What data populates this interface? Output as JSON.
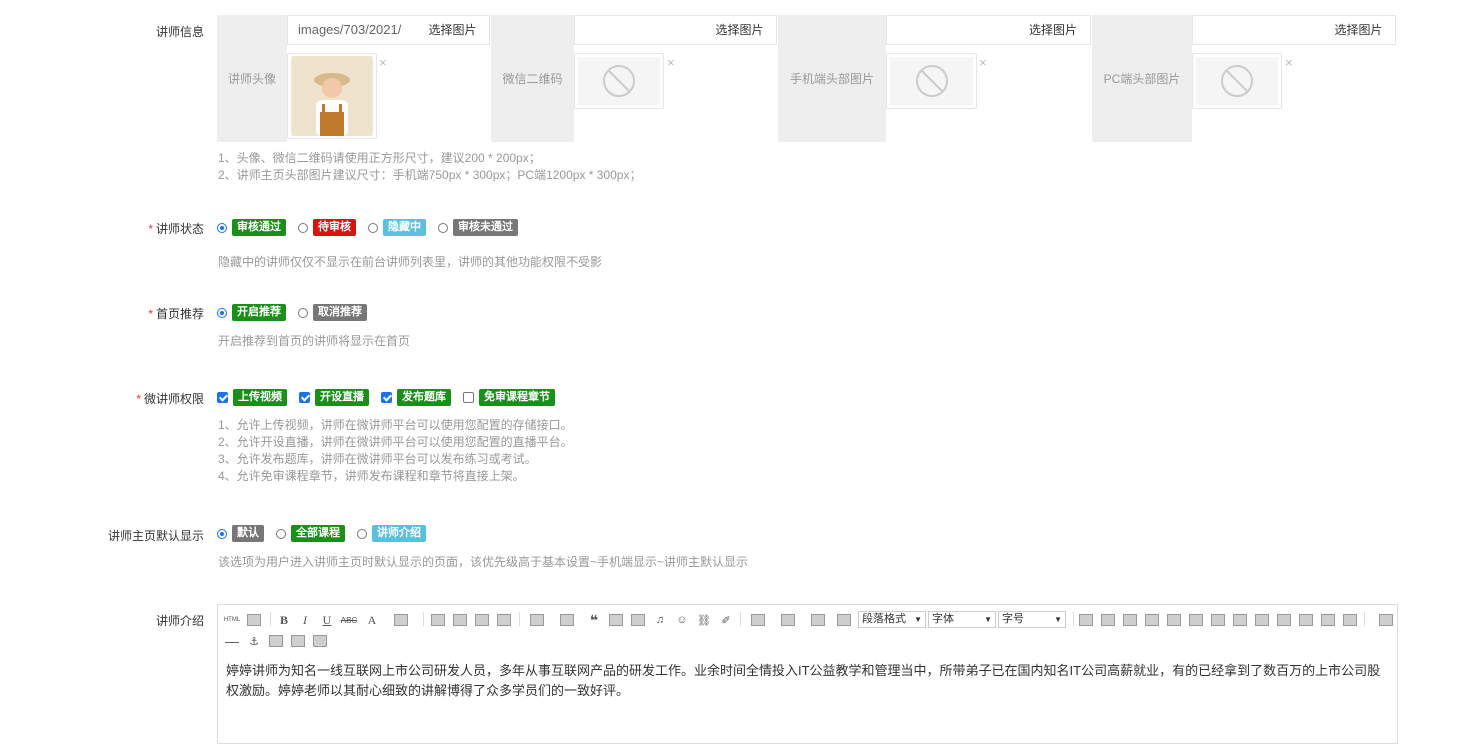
{
  "teacher_info": {
    "label": "讲师信息",
    "pickers": [
      {
        "side_label": "讲师头像",
        "value": "images/703/2021/",
        "button": "选择图片",
        "close": "×"
      },
      {
        "side_label": "微信二维码",
        "value": "",
        "button": "选择图片",
        "close": "×",
        "placeholder_text": "暂无图片"
      },
      {
        "side_label": "手机端头部图片",
        "value": "",
        "button": "选择图片",
        "close": "×",
        "placeholder_text": "暂无图片"
      },
      {
        "side_label": "PC端头部图片",
        "value": "",
        "button": "选择图片",
        "close": "×",
        "placeholder_text": "暂无图片"
      }
    ],
    "hints": [
      "1、头像、微信二维码请使用正方形尺寸，建议200 * 200px；",
      "2、讲师主页头部图片建议尺寸：手机端750px * 300px；PC端1200px * 300px；"
    ]
  },
  "status": {
    "label": "讲师状态",
    "options": [
      {
        "label": "审核通过",
        "color": "#1a8f1a",
        "checked": true
      },
      {
        "label": "待审核",
        "color": "#d9140f",
        "checked": false
      },
      {
        "label": "隐藏中",
        "color": "#5bc0de",
        "checked": false
      },
      {
        "label": "审核未通过",
        "color": "#777777",
        "checked": false
      }
    ],
    "hint": "隐藏中的讲师仅仅不显示在前台讲师列表里，讲师的其他功能权限不受影"
  },
  "recommend": {
    "label": "首页推荐",
    "options": [
      {
        "label": "开启推荐",
        "color": "#1a8f1a",
        "checked": true
      },
      {
        "label": "取消推荐",
        "color": "#777777",
        "checked": false
      }
    ],
    "hint": "开启推荐到首页的讲师将显示在首页"
  },
  "permissions": {
    "label": "微讲师权限",
    "options": [
      {
        "label": "上传视频",
        "color": "#1a8f1a",
        "checked": true
      },
      {
        "label": "开设直播",
        "color": "#1a8f1a",
        "checked": true
      },
      {
        "label": "发布题库",
        "color": "#1a8f1a",
        "checked": true
      },
      {
        "label": "免审课程章节",
        "color": "#1a8f1a",
        "checked": false
      }
    ],
    "hints": [
      "1、允许上传视频，讲师在微讲师平台可以使用您配置的存储接口。",
      "2、允许开设直播，讲师在微讲师平台可以使用您配置的直播平台。",
      "3、允许发布题库，讲师在微讲师平台可以发布练习或考试。",
      "4、允许免审课程章节，讲师发布课程和章节将直接上架。"
    ]
  },
  "homepage_default": {
    "label": "讲师主页默认显示",
    "options": [
      {
        "label": "默认",
        "color": "#777777",
        "checked": true
      },
      {
        "label": "全部课程",
        "color": "#1a8f1a",
        "checked": false
      },
      {
        "label": "讲师介绍",
        "color": "#5bc0de",
        "checked": false
      }
    ],
    "hint": "该选项为用户进入讲师主页时默认显示的页面，该优先级高于基本设置~手机端显示~讲师主默认显示"
  },
  "intro": {
    "label": "讲师介绍",
    "toolbar": {
      "html_label": "HTML",
      "bold": "B",
      "italic": "I",
      "underline": "U",
      "strike": "ABC",
      "font_color": "A",
      "selects": [
        "段落格式",
        "字体",
        "字号"
      ]
    },
    "content": "婷婷讲师为知名一线互联网上市公司研发人员，多年从事互联网产品的研发工作。业余时间全情投入IT公益教学和管理当中，所带弟子已在国内知名IT公司高薪就业，有的已经拿到了数百万的上市公司股权激励。婷婷老师以其耐心细致的讲解博得了众多学员们的一致好评。"
  }
}
